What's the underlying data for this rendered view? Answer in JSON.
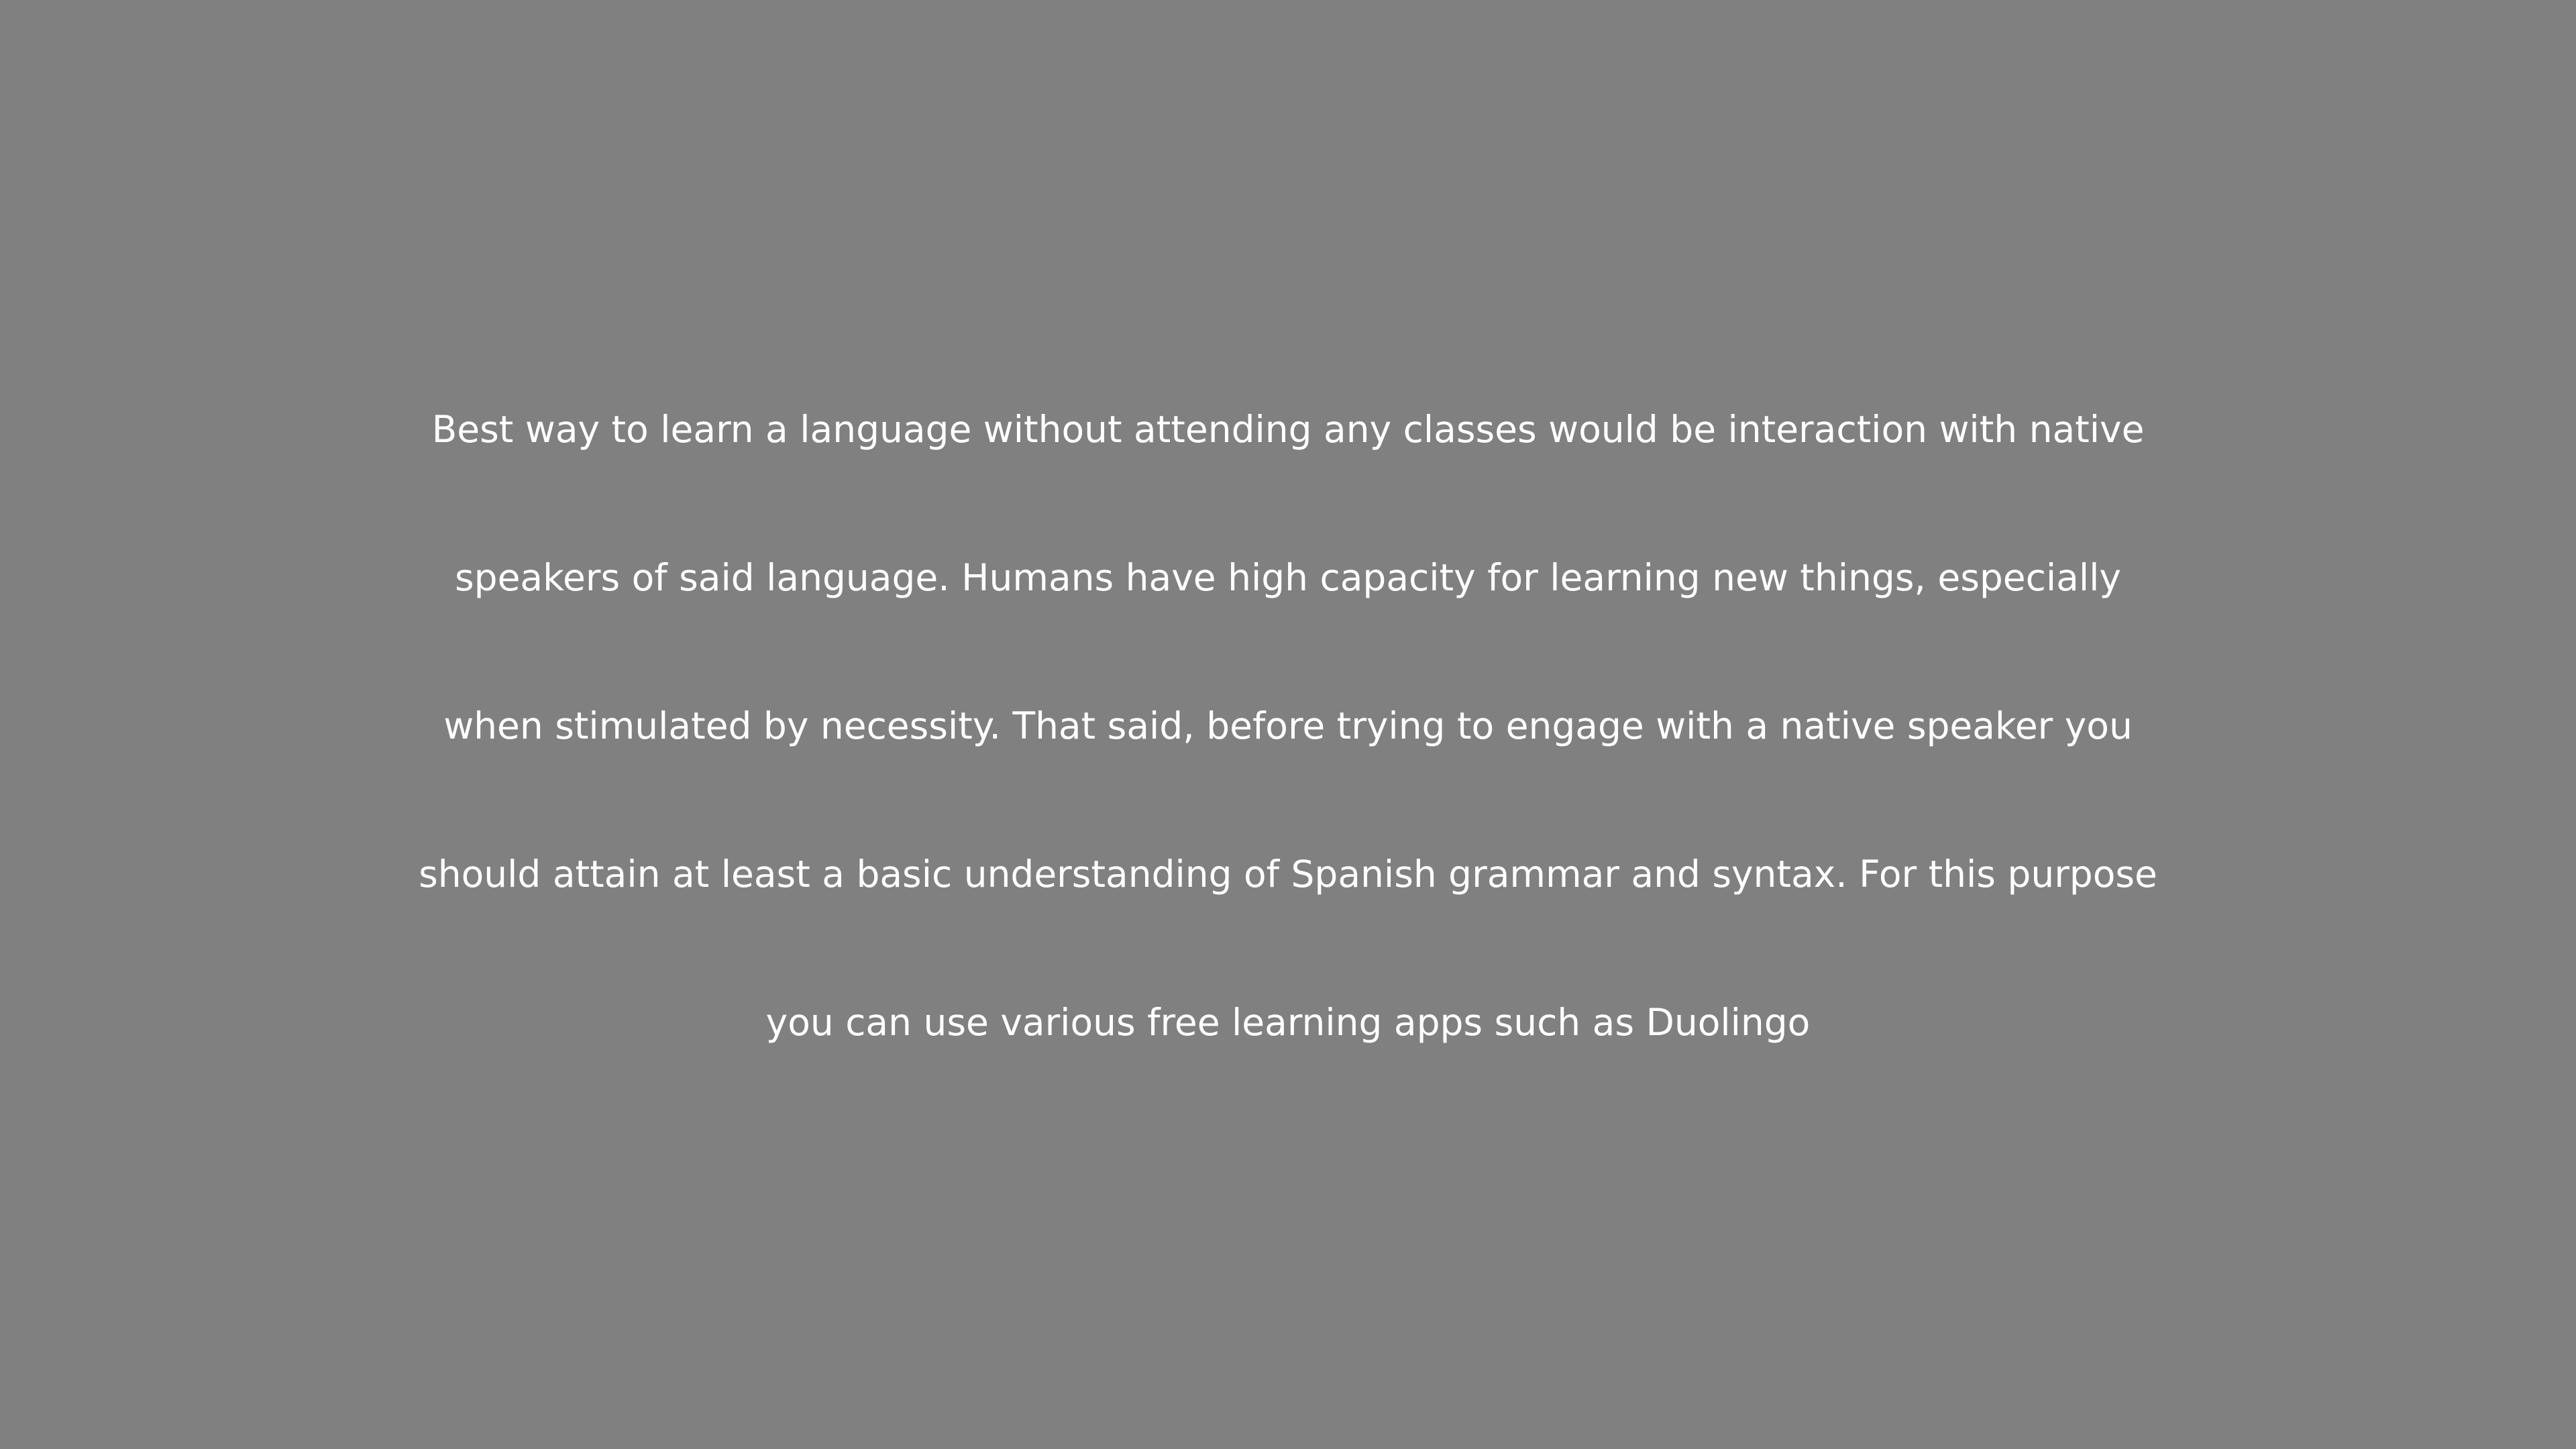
{
  "background_color": "#808080",
  "text_color": "#ffffff",
  "lines": [
    "Best way to learn a language without attending any classes would be interaction with native",
    "speakers of said language. Humans have high capacity for learning new things, especially",
    "when stimulated by necessity. That said, before trying to engage with a native speaker you",
    "should attain at least a basic understanding of Spanish grammar and syntax. For this purpose",
    "you can use various free learning apps such as Duolingo"
  ]
}
